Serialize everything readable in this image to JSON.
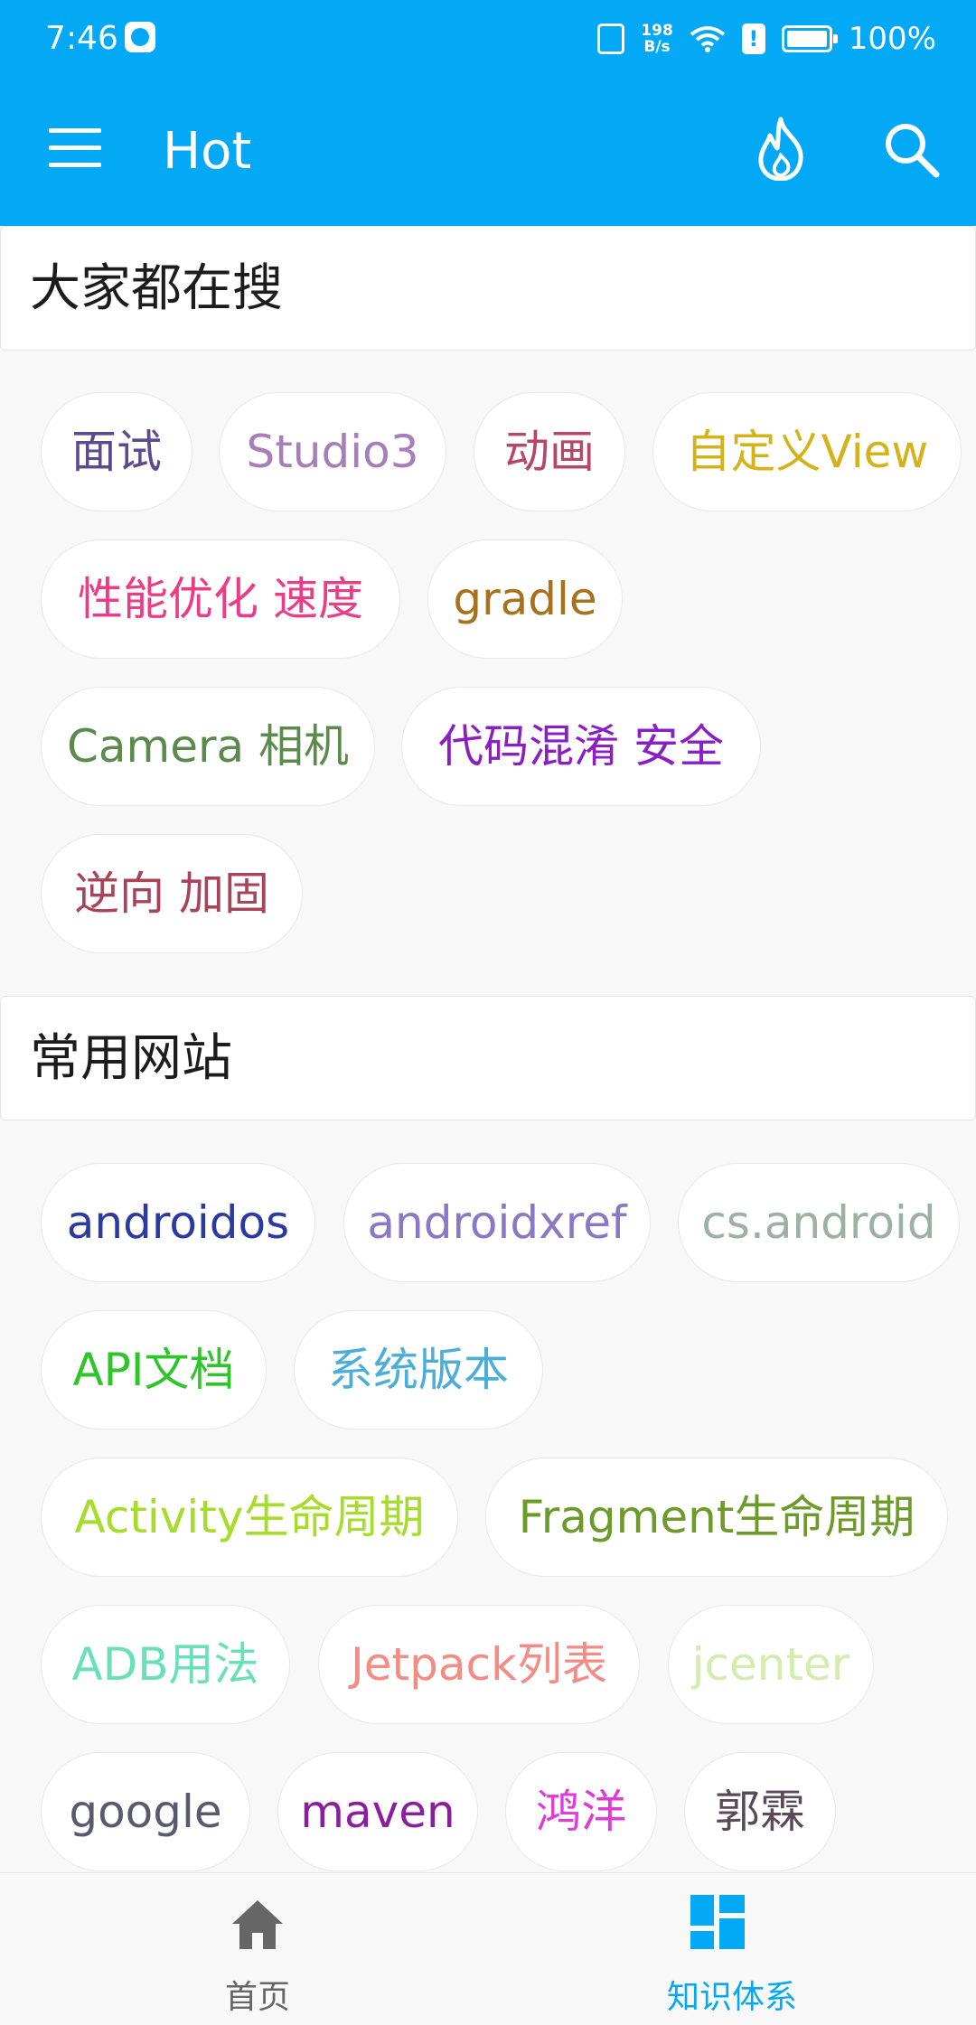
{
  "status_bar": {
    "time": "7:46",
    "speed_value": "198",
    "speed_unit": "B/s",
    "battery": "100%"
  },
  "app_bar": {
    "title": "Hot",
    "bg_color": "#03a9f4"
  },
  "sections": [
    {
      "title": "大家都在搜",
      "tags": [
        {
          "label": "面试",
          "color": "#5c4a8f"
        },
        {
          "label": "Studio3",
          "color": "#a67fb8"
        },
        {
          "label": "动画",
          "color": "#b8456a"
        },
        {
          "label": "自定义View",
          "color": "#d4b21a"
        },
        {
          "label": "性能优化 速度",
          "color": "#ea3d86"
        },
        {
          "label": "gradle",
          "color": "#a8721c"
        },
        {
          "label": "Camera 相机",
          "color": "#5c8a4c"
        },
        {
          "label": "代码混淆 安全",
          "color": "#8a1fc4"
        },
        {
          "label": "逆向 加固",
          "color": "#a8445a"
        }
      ]
    },
    {
      "title": "常用网站",
      "tags": [
        {
          "label": "androidos",
          "color": "#2a3aa0"
        },
        {
          "label": "androidxref",
          "color": "#8a78c4"
        },
        {
          "label": "cs.android",
          "color": "#9cb0a4"
        },
        {
          "label": "API文档",
          "color": "#2ec42a"
        },
        {
          "label": "系统版本",
          "color": "#4aaed8"
        },
        {
          "label": "Activity生命周期",
          "color": "#a6dc2a"
        },
        {
          "label": "Fragment生命周期",
          "color": "#6e9a2a"
        },
        {
          "label": "ADB用法",
          "color": "#6ae0b8"
        },
        {
          "label": "Jetpack列表",
          "color": "#f28c84"
        },
        {
          "label": "jcenter",
          "color": "#d4ecb0"
        },
        {
          "label": "google",
          "color": "#5a5a6e"
        },
        {
          "label": "maven",
          "color": "#8a1f9e"
        },
        {
          "label": "鸿洋",
          "color": "#e03ad8"
        },
        {
          "label": "郭霖",
          "color": "#5a4a58"
        }
      ]
    }
  ],
  "bottom_nav": [
    {
      "label": "首页",
      "color": "#666666",
      "active": false
    },
    {
      "label": "知识体系",
      "color": "#03a9f4",
      "active": true
    }
  ]
}
